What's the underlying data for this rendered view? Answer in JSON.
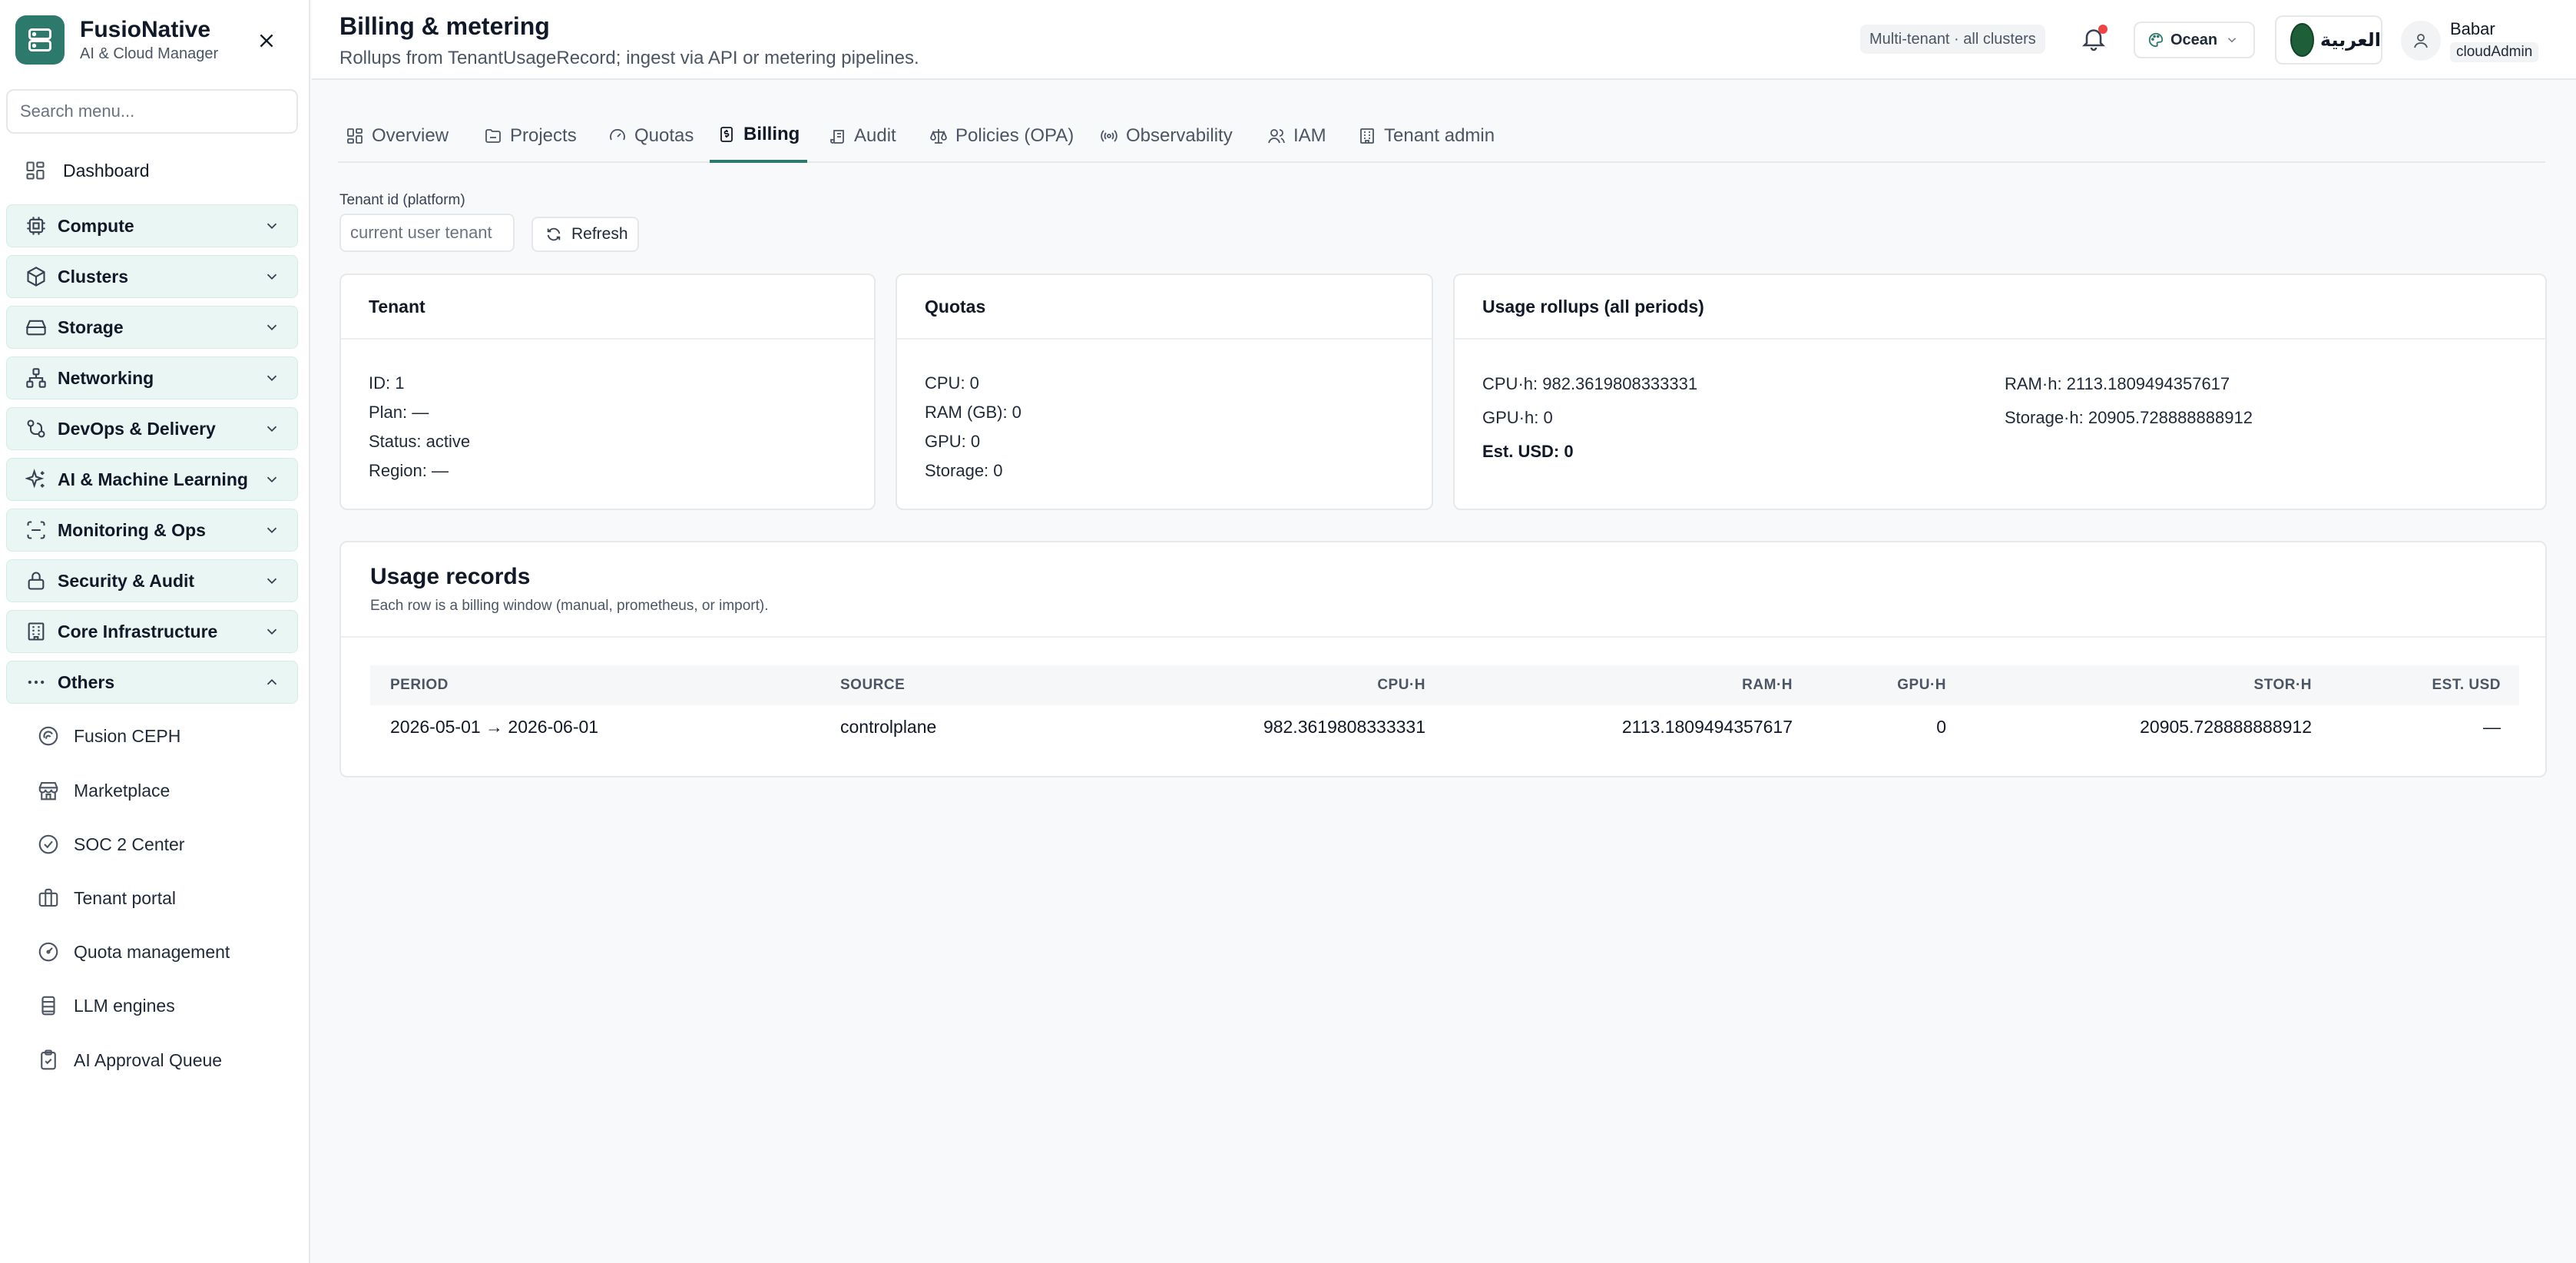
{
  "brand": {
    "name": "FusioNative",
    "subtitle": "AI & Cloud Manager"
  },
  "sidebar": {
    "search_placeholder": "Search menu...",
    "dashboard": "Dashboard",
    "groups": [
      {
        "label": "Compute",
        "icon": "cpu-icon"
      },
      {
        "label": "Clusters",
        "icon": "box-icon"
      },
      {
        "label": "Storage",
        "icon": "hard-drive-icon"
      },
      {
        "label": "Networking",
        "icon": "network-icon"
      },
      {
        "label": "DevOps & Delivery",
        "icon": "git-icon"
      },
      {
        "label": "AI & Machine Learning",
        "icon": "sparkles-icon"
      },
      {
        "label": "Monitoring & Ops",
        "icon": "scan-icon"
      },
      {
        "label": "Security & Audit",
        "icon": "lock-icon"
      },
      {
        "label": "Core Infrastructure",
        "icon": "building-icon"
      },
      {
        "label": "Others",
        "icon": "more-icon",
        "expanded": true
      }
    ],
    "others_items": [
      "Fusion CEPH",
      "Marketplace",
      "SOC 2 Center",
      "Tenant portal",
      "Quota management",
      "LLM engines",
      "AI Approval Queue"
    ]
  },
  "header": {
    "title": "Billing & metering",
    "subtitle": "Rollups from TenantUsageRecord; ingest via API or metering pipelines.",
    "scope_chip": "Multi-tenant · all clusters",
    "theme": "Ocean",
    "language": "العربية",
    "user_name": "Babar",
    "user_role": "cloudAdmin"
  },
  "tabs": [
    "Overview",
    "Projects",
    "Quotas",
    "Billing",
    "Audit",
    "Policies (OPA)",
    "Observability",
    "IAM",
    "Tenant admin"
  ],
  "active_tab": "Billing",
  "tenant_filter": {
    "label": "Tenant id (platform)",
    "placeholder": "current user tenant",
    "refresh": "Refresh"
  },
  "cards": {
    "tenant": {
      "title": "Tenant",
      "id": "ID: 1",
      "plan": "Plan: —",
      "status": "Status: active",
      "region": "Region: —"
    },
    "quotas": {
      "title": "Quotas",
      "cpu": "CPU: 0",
      "ram": "RAM (GB): 0",
      "gpu": "GPU: 0",
      "storage": "Storage: 0"
    },
    "rollups": {
      "title": "Usage rollups (all periods)",
      "cpu_h": "CPU·h: 982.3619808333331",
      "ram_h": "RAM·h: 2113.1809494357617",
      "gpu_h": "GPU·h: 0",
      "storage_h": "Storage·h: 20905.728888888912",
      "est_usd": "Est. USD: 0"
    }
  },
  "records": {
    "title": "Usage records",
    "subtitle": "Each row is a billing window (manual, prometheus, or import).",
    "columns": [
      "PERIOD",
      "SOURCE",
      "CPU·H",
      "RAM·H",
      "GPU·H",
      "STOR·H",
      "EST. USD"
    ],
    "rows": [
      {
        "period": "2026-05-01 → 2026-06-01",
        "source": "controlplane",
        "cpu_h": "982.3619808333331",
        "ram_h": "2113.1809494357617",
        "gpu_h": "0",
        "stor_h": "20905.728888888912",
        "est_usd": "—"
      }
    ]
  },
  "colors": {
    "accent": "#2d7a6c",
    "group_bg": "#e9f6f3",
    "notification_dot": "#ef4444"
  }
}
